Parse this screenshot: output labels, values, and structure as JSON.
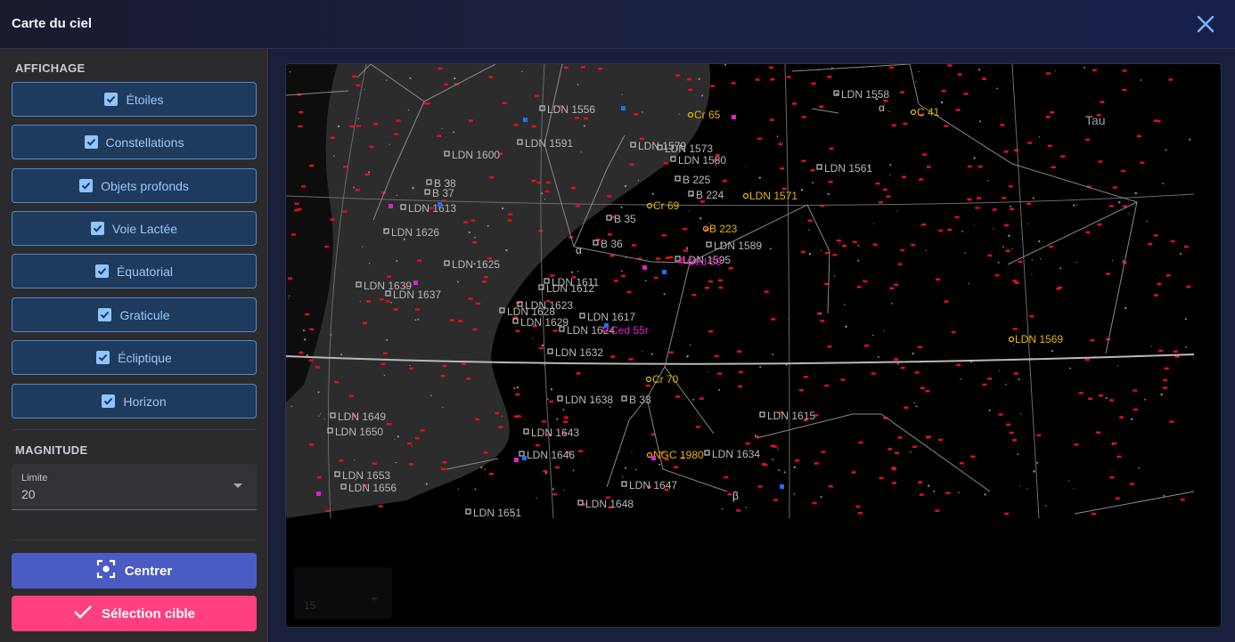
{
  "window": {
    "title": "Carte du ciel",
    "close_icon": "close-icon"
  },
  "sidebar": {
    "display_section": "AFFICHAGE",
    "toggles": [
      {
        "label": "Étoiles",
        "checked": true
      },
      {
        "label": "Constellations",
        "checked": true
      },
      {
        "label": "Objets profonds",
        "checked": true
      },
      {
        "label": "Voie Lactée",
        "checked": true
      },
      {
        "label": "Équatorial",
        "checked": true
      },
      {
        "label": "Graticule",
        "checked": true
      },
      {
        "label": "Écliptique",
        "checked": true
      },
      {
        "label": "Horizon",
        "checked": true
      }
    ],
    "magnitude_section": "MAGNITUDE",
    "limit_select": {
      "label": "Limite",
      "value": "20"
    },
    "center_button": {
      "label": "Centrer",
      "icon": "center-focus-icon"
    },
    "target_button": {
      "label": "Sélection cible",
      "icon": "check-icon"
    }
  },
  "map": {
    "colors": {
      "star_red": "#e0101a",
      "object_yellow": "#e6b400",
      "object_grey": "#b8b8b8",
      "object_magenta": "#e020c8",
      "object_blue": "#1e6fff",
      "milky_way": "#2c2c2c"
    },
    "constellation_label": "Tau",
    "star_labels": [
      "α",
      "α",
      "β"
    ],
    "objects": [
      {
        "name": "LDN 1558",
        "color": "grey"
      },
      {
        "name": "C 41",
        "color": "yellow"
      },
      {
        "name": "LDN 1556",
        "color": "grey"
      },
      {
        "name": "Cr 65",
        "color": "yellow"
      },
      {
        "name": "LDN 1591",
        "color": "grey"
      },
      {
        "name": "LDN 1600",
        "color": "grey"
      },
      {
        "name": "LDN 1579",
        "color": "grey"
      },
      {
        "name": "LDN 1573",
        "color": "grey"
      },
      {
        "name": "LDN 1580",
        "color": "grey"
      },
      {
        "name": "LDN 1561",
        "color": "grey"
      },
      {
        "name": "B 38",
        "color": "grey"
      },
      {
        "name": "B 37",
        "color": "grey"
      },
      {
        "name": "B 225",
        "color": "grey"
      },
      {
        "name": "B 224",
        "color": "grey"
      },
      {
        "name": "LDN 1571",
        "color": "yellow"
      },
      {
        "name": "LDN 1613",
        "color": "grey"
      },
      {
        "name": "Cr 69",
        "color": "yellow"
      },
      {
        "name": "B 35",
        "color": "grey"
      },
      {
        "name": "LDN 1626",
        "color": "grey"
      },
      {
        "name": "B 223",
        "color": "yellow"
      },
      {
        "name": "B 36",
        "color": "grey"
      },
      {
        "name": "LDN 1589",
        "color": "grey"
      },
      {
        "name": "LDN 1595",
        "color": "grey"
      },
      {
        "name": "Ced 59",
        "color": "magenta"
      },
      {
        "name": "LDN 1625",
        "color": "grey"
      },
      {
        "name": "LDN 1611",
        "color": "grey"
      },
      {
        "name": "LDN 1639",
        "color": "grey"
      },
      {
        "name": "LDN 1612",
        "color": "grey"
      },
      {
        "name": "LDN 1637",
        "color": "grey"
      },
      {
        "name": "LDN 1623",
        "color": "grey"
      },
      {
        "name": "LDN 1628",
        "color": "grey"
      },
      {
        "name": "LDN 1617",
        "color": "grey"
      },
      {
        "name": "LDN 1629",
        "color": "grey"
      },
      {
        "name": "LDN 1624",
        "color": "grey"
      },
      {
        "name": "Ced 55r",
        "color": "magenta"
      },
      {
        "name": "LDN 1569",
        "color": "yellow"
      },
      {
        "name": "LDN 1632",
        "color": "grey"
      },
      {
        "name": "Cr 70",
        "color": "yellow"
      },
      {
        "name": "LDN 1638",
        "color": "grey"
      },
      {
        "name": "B 33",
        "color": "grey"
      },
      {
        "name": "LDN 1615",
        "color": "grey"
      },
      {
        "name": "LDN 1649",
        "color": "grey"
      },
      {
        "name": "LDN 1650",
        "color": "grey"
      },
      {
        "name": "LDN 1643",
        "color": "grey"
      },
      {
        "name": "NGC 1980",
        "color": "yellow"
      },
      {
        "name": "LDN 1634",
        "color": "grey"
      },
      {
        "name": "LDN 1646",
        "color": "grey"
      },
      {
        "name": "LDN 1653",
        "color": "grey"
      },
      {
        "name": "LDN 1656",
        "color": "grey"
      },
      {
        "name": "LDN 1647",
        "color": "grey"
      },
      {
        "name": "LDN 1648",
        "color": "grey"
      },
      {
        "name": "LDN 1651",
        "color": "grey"
      }
    ],
    "overlay_select": {
      "value": "15"
    }
  }
}
